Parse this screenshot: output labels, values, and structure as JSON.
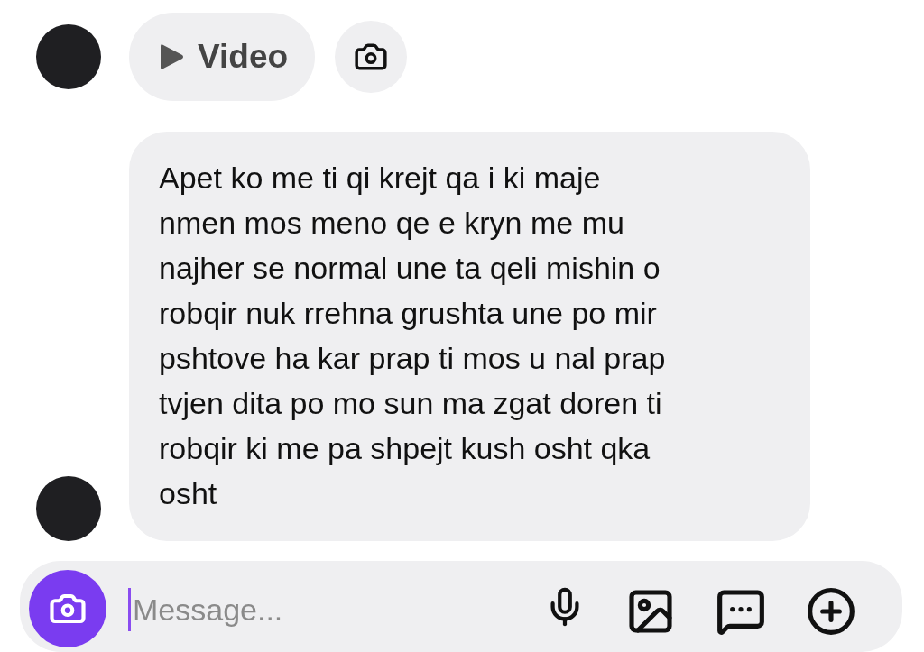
{
  "top_row": {
    "video_button": {
      "label": "Video"
    }
  },
  "message": {
    "lines": [
      "Apet ko me ti qi krejt qa i ki maje",
      "nmen mos meno qe e kryn me mu",
      "najher se normal une ta qeli mishin o",
      "robqir nuk rrehna grushta une po mir",
      "pshtove ha kar prap ti mos u nal prap",
      "tvjen dita po mo sun ma zgat doren ti",
      "robqir ki me pa shpejt kush osht qka",
      "osht"
    ]
  },
  "composer": {
    "placeholder": "Message..."
  }
}
